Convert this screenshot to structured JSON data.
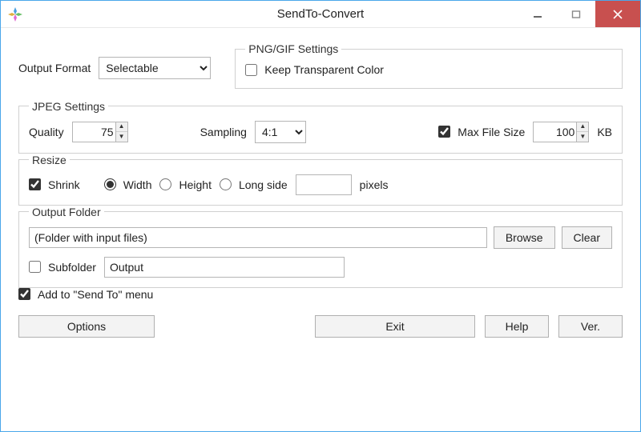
{
  "window": {
    "title": "SendTo-Convert"
  },
  "outputFormat": {
    "label": "Output Format",
    "value": "Selectable"
  },
  "pnggif": {
    "legend": "PNG/GIF Settings",
    "keepTransparent": {
      "label": "Keep Transparent Color",
      "checked": false
    }
  },
  "jpeg": {
    "legend": "JPEG Settings",
    "quality": {
      "label": "Quality",
      "value": "75"
    },
    "sampling": {
      "label": "Sampling",
      "value": "4:1"
    },
    "maxFileSize": {
      "label": "Max File Size",
      "checked": true,
      "value": "100",
      "unit": "KB"
    }
  },
  "resize": {
    "legend": "Resize",
    "shrink": {
      "label": "Shrink",
      "checked": true
    },
    "mode": {
      "selected": "width",
      "width": "Width",
      "height": "Height",
      "longside": "Long side"
    },
    "pixels": {
      "label": "pixels",
      "value": ""
    }
  },
  "outputFolder": {
    "legend": "Output Folder",
    "path": "(Folder with input files)",
    "browse": "Browse",
    "clear": "Clear",
    "subfolder": {
      "label": "Subfolder",
      "checked": false,
      "value": "Output"
    }
  },
  "addToSendTo": {
    "label": "Add to \"Send To\" menu",
    "checked": true
  },
  "buttons": {
    "options": "Options",
    "exit": "Exit",
    "help": "Help",
    "ver": "Ver."
  }
}
